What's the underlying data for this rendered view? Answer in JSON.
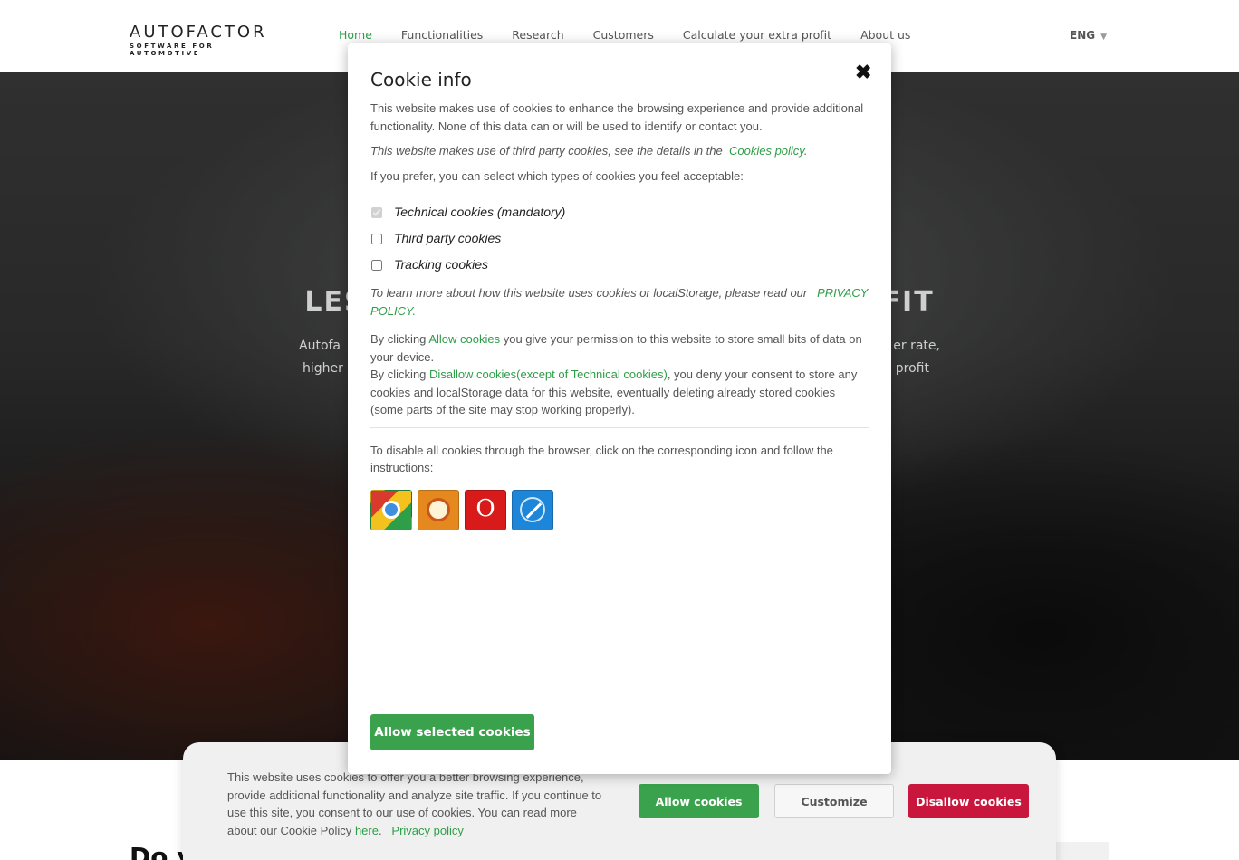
{
  "header": {
    "logo_word": "AUTOFACTOR",
    "logo_sub": "SOFTWARE FOR AUTOMOTIVE",
    "nav": [
      "Home",
      "Functionalities",
      "Research",
      "Customers",
      "Calculate your extra profit",
      "About us"
    ],
    "active_index": 0,
    "lang": "ENG"
  },
  "hero": {
    "title_left": "LES",
    "title_right": "FIT",
    "line1_left": "Autofa",
    "line1_right": "er rate,",
    "line2_left": "higher",
    "line2_right": "profit"
  },
  "below": {
    "heading": "Do y"
  },
  "banner": {
    "text": "This website uses cookies to offer you a better browsing experience, provide additional functionality and analyze site traffic. If you continue to use this site, you consent to our use of cookies. You can read more about our Cookie Policy",
    "here_link": "here",
    "privacy_link": "Privacy policy",
    "allow_label": "Allow cookies",
    "customize_label": "Customize",
    "disallow_label": "Disallow cookies"
  },
  "modal": {
    "title": "Cookie info",
    "close_glyph": "✖",
    "intro": "This website makes use of cookies to enhance the browsing experience and provide additional functionality. None of this data can or will be used to identify or contact you.",
    "third_party_text": "This website makes use of third party cookies, see the details in the",
    "cookies_policy_link": "Cookies policy",
    "select_text": "If you prefer, you can select which types of cookies you feel acceptable:",
    "checkboxes": [
      {
        "label": "Technical cookies (mandatory)",
        "checked": true,
        "disabled": true
      },
      {
        "label": "Third party cookies",
        "checked": false,
        "disabled": false
      },
      {
        "label": "Tracking cookies",
        "checked": false,
        "disabled": false
      }
    ],
    "learn_more_text": "To learn more about how this website uses cookies or localStorage, please read our",
    "privacy_policy_link": "PRIVACY POLICY.",
    "by_clicking_1": "By clicking",
    "allow_link": "Allow cookies",
    "allow_desc": "you give your permission to this website to store small bits of data on your device.",
    "by_clicking_2": "By clicking",
    "disallow_link": "Disallow cookies(except of Technical cookies)",
    "disallow_desc": ", you deny your consent to store any cookies and localStorage data for this website, eventually deleting already stored cookies (some parts of the site may stop working properly).",
    "browser_text": "To disable all cookies through the browser, click on the corresponding icon and follow the instructions:",
    "browsers": [
      "chrome-icon",
      "firefox-icon",
      "opera-icon",
      "safari-icon"
    ],
    "opera_glyph": "O",
    "allow_selected_label": "Allow selected cookies"
  },
  "colors": {
    "accent": "#2e9e48",
    "disallow": "#c8163d"
  }
}
